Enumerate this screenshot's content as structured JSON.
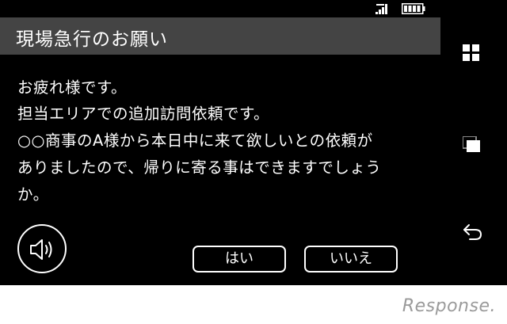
{
  "dialog": {
    "title": "現場急行のお願い",
    "message_lines": [
      "お疲れ様です。",
      "担当エリアでの追加訪問依頼です。",
      "○○商事のA様から本日中に来て欲しいとの依頼が",
      "ありましたので、帰りに寄る事はできますでしょう",
      "か。"
    ],
    "yes_label": "はい",
    "no_label": "いいえ"
  },
  "icons": {
    "speaker": "speaker-icon",
    "signal": "signal-icon",
    "battery": "battery-icon",
    "apps": "apps-grid-icon",
    "recents": "recent-apps-icon",
    "back": "back-icon"
  },
  "watermark": "Response.",
  "colors": {
    "background": "#000000",
    "title_bar": "#444444",
    "text": "#ffffff",
    "watermark": "#9a9a9a"
  }
}
